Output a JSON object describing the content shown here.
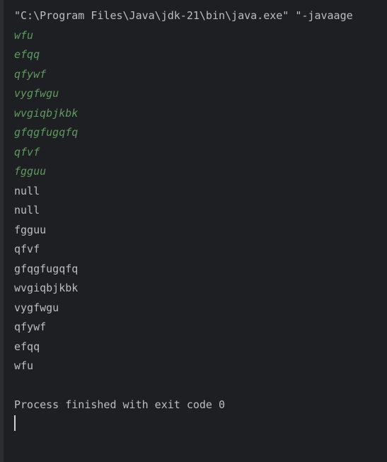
{
  "console": {
    "command_line": "\"C:\\Program Files\\Java\\jdk-21\\bin\\java.exe\" \"-javaage",
    "user_input": [
      "wfu",
      "efqq",
      "qfywf",
      "vygfwgu",
      "wvgiqbjkbk",
      "gfqgfugqfq",
      "qfvf",
      "fgguu"
    ],
    "program_output": [
      "null",
      "null",
      "fgguu",
      "qfvf",
      "gfqgfugqfq",
      "wvgiqbjkbk",
      "vygfwgu",
      "qfywf",
      "efqq",
      "wfu"
    ],
    "exit_message": "Process finished with exit code 0"
  },
  "colors": {
    "background": "#1e1f22",
    "gutter": "#2b2d30",
    "text": "#bcbec4",
    "input_text": "#5f9a5f",
    "caret": "#ced0d6"
  }
}
